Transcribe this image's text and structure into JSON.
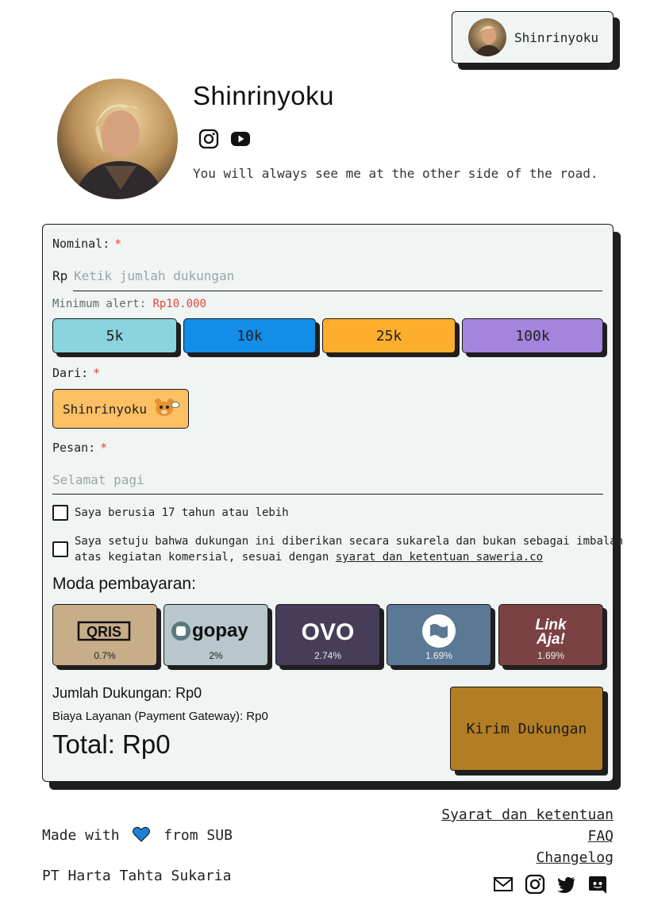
{
  "user": {
    "name": "Shinrinyoku"
  },
  "profile": {
    "name": "Shinrinyoku",
    "bio": "You will always see me at the other side of the road."
  },
  "form": {
    "nominal_label": "Nominal:",
    "required_mark": "*",
    "currency": "Rp",
    "amount_placeholder": "Ketik jumlah dukungan",
    "min_alert_label": "Minimum alert:",
    "min_alert_value": "Rp10.000",
    "presets": [
      {
        "label": "5k",
        "color": "#8bd3dd"
      },
      {
        "label": "10k",
        "color": "#128de8"
      },
      {
        "label": "25k",
        "color": "#fcae2c"
      },
      {
        "label": "100k",
        "color": "#a584de"
      }
    ],
    "from_label": "Dari:",
    "from_value": "Shinrinyoku",
    "message_label": "Pesan:",
    "message_placeholder": "Selamat pagi",
    "age_check": "Saya berusia 17 tahun atau lebih",
    "agree_check_line1": "Saya setuju bahwa dukungan ini diberikan secara sukarela dan bukan sebagai imbalan",
    "agree_check_line2": "atas kegiatan komersial, sesuai dengan",
    "agree_link": "syarat dan ketentuan saweria.co"
  },
  "payment": {
    "title": "Moda pembayaran:",
    "methods": [
      {
        "name": "QRIS",
        "fee": "0.7%",
        "bg": "#c7ae88"
      },
      {
        "name": "gopay",
        "fee": "2%",
        "bg": "#b7c7cb"
      },
      {
        "name": "OVO",
        "fee": "2.74%",
        "bg": "#473d58"
      },
      {
        "name": "DANA",
        "fee": "1.69%",
        "bg": "#5b7894"
      },
      {
        "name": "LinkAja!",
        "fee": "1.69%",
        "bg": "#7a4242"
      }
    ]
  },
  "summary": {
    "amount": "Jumlah Dukungan: Rp0",
    "fee": "Biaya Layanan (Payment Gateway): Rp0",
    "total": "Total: Rp0",
    "submit": "Kirim Dukungan"
  },
  "footer": {
    "made_with": "Made with",
    "from_text": "from SUB",
    "company": "PT Harta Tahta Sukaria",
    "links": [
      "Syarat dan ketentuan",
      "FAQ",
      "Changelog"
    ]
  },
  "colors": {
    "card_bg": "#f0f4f3",
    "required": "#e0463e",
    "submit": "#b37d23",
    "heart": "#1d7fd6"
  }
}
